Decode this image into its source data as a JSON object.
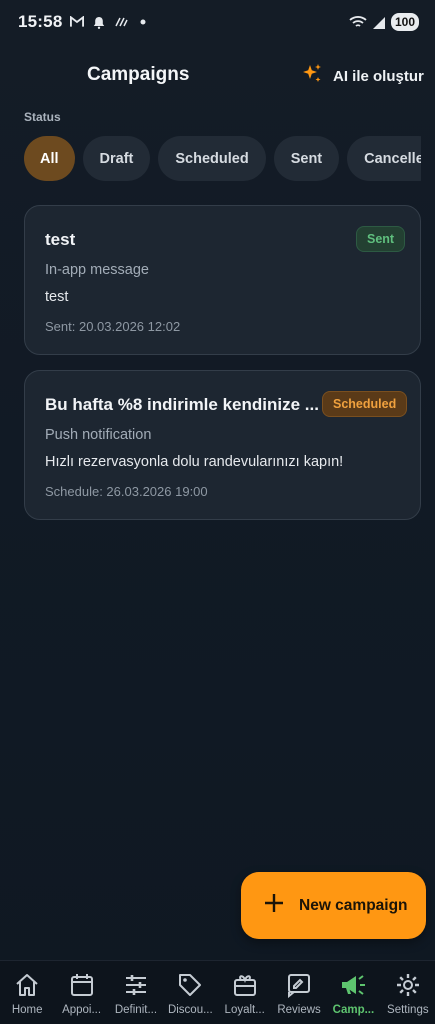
{
  "status_bar": {
    "time": "15:58",
    "battery": "100"
  },
  "header": {
    "title": "Campaigns",
    "ai_button_label": "AI ile oluştur"
  },
  "filters": {
    "label": "Status",
    "chips": [
      "All",
      "Draft",
      "Scheduled",
      "Sent",
      "Cancelle"
    ],
    "selected": "All"
  },
  "campaigns": [
    {
      "title": "test",
      "status": "Sent",
      "type": "In-app message",
      "body": "test",
      "date": "Sent: 20.03.2026 12:02"
    },
    {
      "title": "Bu hafta %8 indirimle kendinize ...",
      "status": "Scheduled",
      "type": "Push notification",
      "body": "Hızlı rezervasyonla dolu randevularınızı kapın!",
      "date": "Schedule: 26.03.2026 19:00"
    }
  ],
  "fab": {
    "label": "New campaign"
  },
  "bottom_nav": {
    "items": [
      {
        "label": "Home",
        "icon": "home-icon"
      },
      {
        "label": "Appoi...",
        "icon": "calendar-icon"
      },
      {
        "label": "Definit...",
        "icon": "sliders-icon"
      },
      {
        "label": "Discou...",
        "icon": "tag-icon"
      },
      {
        "label": "Loyalt...",
        "icon": "gift-card-icon"
      },
      {
        "label": "Reviews",
        "icon": "review-icon"
      },
      {
        "label": "Camp...",
        "icon": "megaphone-icon"
      },
      {
        "label": "Settings",
        "icon": "gear-icon"
      }
    ],
    "active": "Camp..."
  },
  "colors": {
    "accent": "#ff9712",
    "active_nav": "#5ec46f",
    "sent_badge": "#5fbf7e",
    "scheduled_badge": "#f0a13e"
  }
}
